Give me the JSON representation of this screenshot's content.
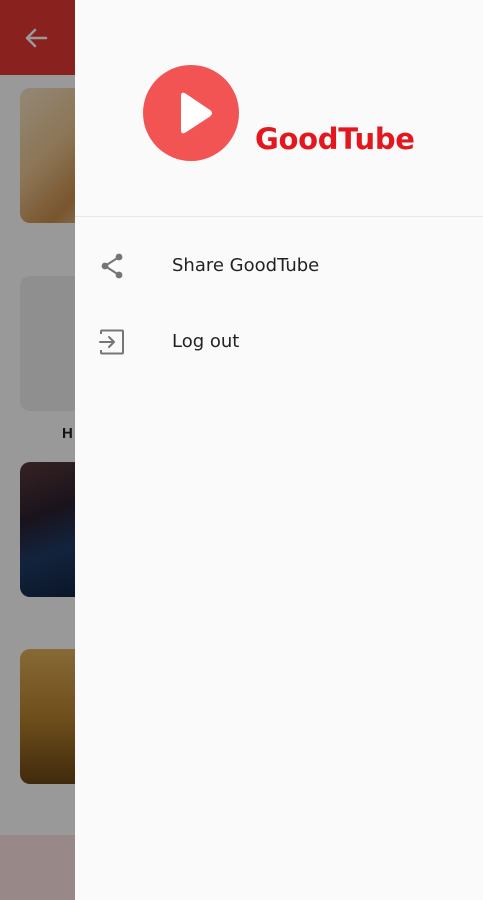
{
  "background_app": {
    "caption_partial": "H",
    "accent_color": "#e53935"
  },
  "drawer": {
    "brand_name": "GoodTube",
    "brand_color": "#e3171e",
    "logo_color": "#f25353",
    "logo_icon": "play-icon",
    "menu": [
      {
        "label": "Share GoodTube",
        "icon": "share-icon"
      },
      {
        "label": "Log out",
        "icon": "logout-icon"
      }
    ]
  }
}
